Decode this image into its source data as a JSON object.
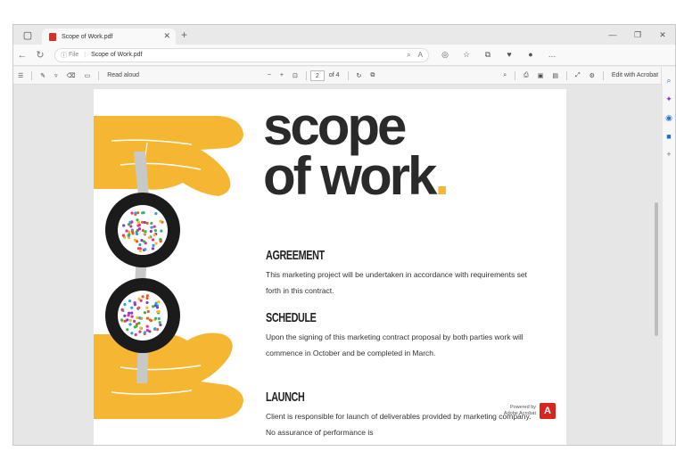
{
  "tab": {
    "title": "Scope of Work.pdf"
  },
  "addressbar": {
    "file_label": "File",
    "url": "Scope of Work.pdf"
  },
  "toolbar": {
    "read_aloud": "Read aloud",
    "page_current": "2",
    "page_total": "of 4",
    "edit_with_acrobat": "Edit with Acrobat"
  },
  "document": {
    "title_line1": "scope",
    "title_line2": "of work",
    "title_dot": ".",
    "sections": [
      {
        "heading": "Agreement",
        "body": "This marketing project will be undertaken in accordance with requirements set forth in this contract."
      },
      {
        "heading": "Schedule",
        "body": "Upon the signing of this marketing contract proposal by both parties work will commence in October and be completed in March."
      },
      {
        "heading": "Launch",
        "body": "Client is responsible for launch of deliverables provided by marketing company. No assurance of performance is"
      }
    ],
    "powered_by": "Powered by",
    "powered_by_brand": "Adobe Acrobat"
  },
  "colors": {
    "accent_yellow": "#f5b731",
    "dark": "#1b1b1b",
    "acrobat_red": "#d7261d"
  }
}
